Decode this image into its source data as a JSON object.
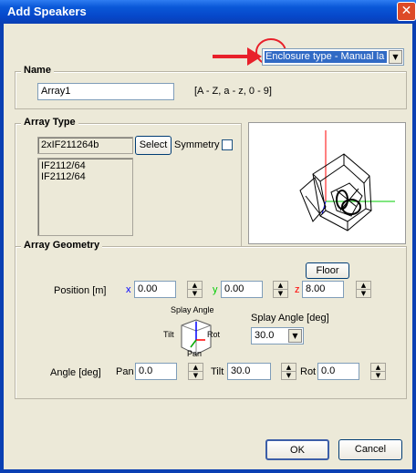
{
  "window": {
    "title": "Add Speakers",
    "close_label": "✕"
  },
  "enclosure_select": {
    "value": "Enclosure type - Manual la"
  },
  "name_group": {
    "label": "Name",
    "value": "Array1",
    "hint": "[A - Z, a - z, 0 - 9]"
  },
  "array_type": {
    "label": "Array Type",
    "type_value": "2xIF211264b",
    "select_label": "Select",
    "symmetry_label": "Symmetry",
    "items": [
      "IF2112/64",
      "IF2112/64"
    ]
  },
  "array_geometry": {
    "label": "Array Geometry",
    "floor_label": "Floor",
    "position_label": "Position [m]",
    "x_label": "x",
    "x_value": "0.00",
    "y_label": "y",
    "y_value": "0.00",
    "z_label": "z",
    "z_value": "8.00",
    "diagram": {
      "splay_label": "Splay Angle",
      "tilt_label": "Tilt",
      "rot_label": "Rot",
      "pan_label": "Pan"
    },
    "splay_angle_label": "Splay Angle [deg]",
    "splay_angle_value": "30.0",
    "angle_label": "Angle [deg]",
    "pan_label": "Pan",
    "pan_value": "0.0",
    "tilt_label": "Tilt",
    "tilt_value": "30.0",
    "rot_label": "Rot",
    "rot_value": "0.0"
  },
  "buttons": {
    "ok": "OK",
    "cancel": "Cancel"
  },
  "colors": {
    "annotation_red": "#e8202a",
    "axis_x": "#00cc00",
    "axis_y": "#0000ff",
    "axis_z": "#ff0000"
  }
}
